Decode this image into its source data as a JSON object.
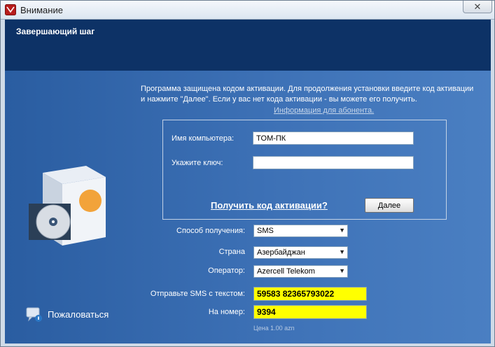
{
  "window": {
    "title": "Внимание"
  },
  "header": {
    "title": "Завершающий шаг"
  },
  "intro": {
    "text": "Программа защищена кодом активации.  Для продолжения установки введите код активации и нажмите \"Далее\". Если у вас нет кода активации - вы можете его получить.",
    "info_link": "Информация для абонента."
  },
  "form": {
    "computer_name_label": "Имя компьютера:",
    "computer_name_value": "TOM-ПК",
    "key_label": "Укажите ключ:",
    "key_value": "",
    "get_code_link": "Получить код активации?",
    "next_button": "Далее"
  },
  "options": {
    "method_label": "Способ получения:",
    "method_value": "SMS",
    "country_label": "Страна",
    "country_value": "Азербайджан",
    "operator_label": "Оператор:",
    "operator_value": "Azercell Telekom",
    "sms_text_label": "Отправьте SMS с текстом:",
    "sms_text_value": "59583 82365793022",
    "number_label": "На номер:",
    "number_value": "9394",
    "price": "Цена 1.00 azn"
  },
  "sidebar": {
    "complain_label": "Пожаловаться"
  },
  "icons": {
    "app": "app-icon",
    "close": "close-icon",
    "complain": "complain-icon",
    "box": "software-box-icon",
    "dropdown": "chevron-down-icon"
  },
  "colors": {
    "header": "#0d3266",
    "panel": "#3f73b8",
    "highlight": "#ffff00"
  }
}
